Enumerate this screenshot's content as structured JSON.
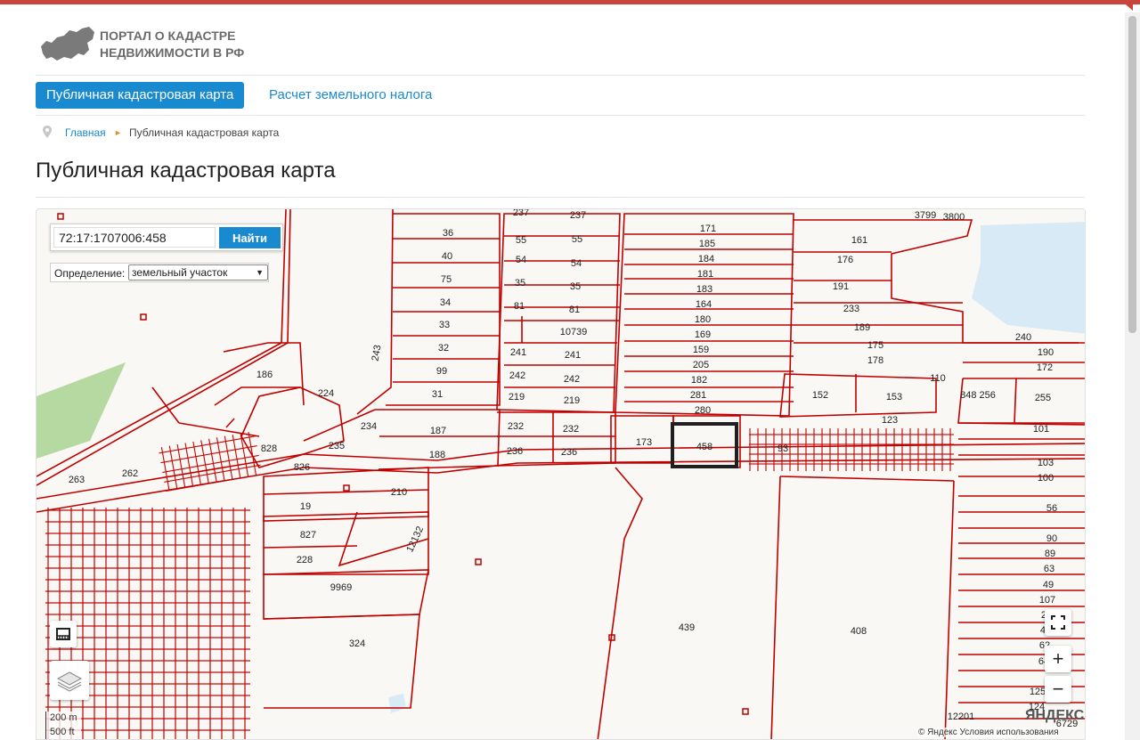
{
  "site": {
    "logo_line1": "ПОРТАЛ О КАДАСТРЕ",
    "logo_line2": "НЕДВИЖИМОСТИ В РФ"
  },
  "nav": {
    "tab_active": "Публичная кадастровая карта",
    "tab_tax": "Расчет земельного налога"
  },
  "breadcrumb": {
    "home": "Главная",
    "separator": "►",
    "current": "Публичная кадастровая карта"
  },
  "page_title": "Публичная кадастровая карта",
  "map": {
    "search_value": "72:17:1707006:458",
    "search_button": "Найти",
    "definition_label": "Определение:",
    "definition_value": "земельный участок",
    "scale_top": "200 m",
    "scale_bottom": "500 ft",
    "yandex_logo": "ЯНДЕКС",
    "copyright": "© Яндекс Условия использования",
    "zoom_in": "+",
    "zoom_out": "−",
    "selected_parcel": "458",
    "parcel_labels": [
      "237",
      "237",
      "36",
      "55",
      "55",
      "171",
      "185",
      "184",
      "181",
      "183",
      "164",
      "180",
      "169",
      "159",
      "205",
      "182",
      "281",
      "280",
      "3799",
      "3800",
      "161",
      "176",
      "191",
      "233",
      "189",
      "175",
      "178",
      "240",
      "190",
      "172",
      "40",
      "54",
      "54",
      "75",
      "35",
      "35",
      "34",
      "81",
      "81",
      "33",
      "10739",
      "32",
      "241",
      "241",
      "99",
      "242",
      "242",
      "31",
      "219",
      "219",
      "243",
      "186",
      "224",
      "152",
      "153",
      "110",
      "848 256",
      "255",
      "123",
      "101",
      "234",
      "187",
      "232",
      "232",
      "173",
      "458",
      "93",
      "828",
      "235",
      "188",
      "236",
      "236",
      "103",
      "100",
      "263",
      "262",
      "826",
      "210",
      "19",
      "56",
      "90",
      "89",
      "63",
      "49",
      "107",
      "20",
      "48",
      "62",
      "64",
      "827",
      "12132",
      "228",
      "9969",
      "324",
      "439",
      "408",
      "125",
      "124",
      "12201",
      "6729"
    ],
    "accent_color": "#c00000",
    "water_color": "#d9eaf7",
    "green_color": "#b5d9a0"
  }
}
